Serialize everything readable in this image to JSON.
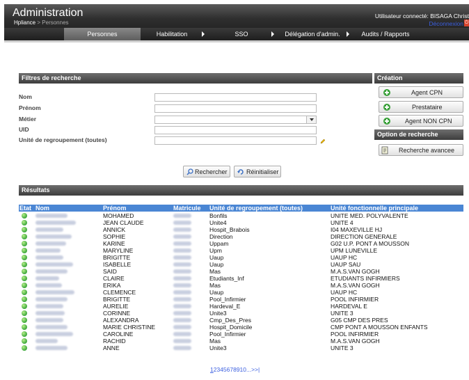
{
  "header": {
    "title": "Administration",
    "breadcrumb_root": "Hpliance",
    "breadcrumb_sep": ">",
    "breadcrumb_current": "Personnes",
    "user_info": "Utilisateur connecté: BISAGA Christ",
    "logout": "Déconnexion"
  },
  "nav": {
    "items": [
      {
        "label": "Personnes"
      },
      {
        "label": "Habilitation"
      },
      {
        "label": "SSO"
      },
      {
        "label": "Délégation d'admin."
      },
      {
        "label": "Audits / Rapports"
      }
    ]
  },
  "filters": {
    "title": "Filtres de recherche",
    "nom_label": "Nom",
    "nom_value": "",
    "prenom_label": "Prénom",
    "prenom_value": "",
    "metier_label": "Métier",
    "metier_value": "",
    "uid_label": "UID",
    "uid_value": "",
    "unite_label": "Unité de regroupement (toutes)",
    "unite_value": "",
    "search_button": "Rechercher",
    "reset_button": "Réinitialiser"
  },
  "creation": {
    "title": "Création",
    "buttons": [
      "Agent CPN",
      "Prestataire",
      "Agent NON CPN"
    ]
  },
  "search_options": {
    "title": "Option de recherche",
    "advanced_button": "Recherche avancee"
  },
  "results": {
    "title": "Résultats",
    "columns": [
      "Etat",
      "Nom",
      "Prénom",
      "Matricule",
      "Unité de regroupement (toutes)",
      "Unité fonctionnelle principale"
    ],
    "rows": [
      {
        "prenom": "MOHAMED",
        "unite": "Bonfils",
        "ufp": "UNITE MED. POLYVALENTE"
      },
      {
        "prenom": "JEAN CLAUDE",
        "unite": "Unite4",
        "ufp": "UNITE 4"
      },
      {
        "prenom": "ANNICK",
        "unite": "Hospit_Brabois",
        "ufp": "I04 MAXEVILLE HJ"
      },
      {
        "prenom": "SOPHIE",
        "unite": "Direction",
        "ufp": "DIRECTION GENERALE"
      },
      {
        "prenom": "KARINE",
        "unite": "Uppam",
        "ufp": "G02 U.P. PONT A MOUSSON"
      },
      {
        "prenom": "MARYLINE",
        "unite": "Upm",
        "ufp": "UPM LUNEVILLE"
      },
      {
        "prenom": "BRIGITTE",
        "unite": "Uaup",
        "ufp": "UAUP HC"
      },
      {
        "prenom": "ISABELLE",
        "unite": "Uaup",
        "ufp": "UAUP SAU"
      },
      {
        "prenom": "SAID",
        "unite": "Mas",
        "ufp": "M.A.S.VAN GOGH"
      },
      {
        "prenom": "CLAIRE",
        "unite": "Etudiants_Inf",
        "ufp": "ETUDIANTS INFIRMIERS"
      },
      {
        "prenom": "ERIKA",
        "unite": "Mas",
        "ufp": "M.A.S.VAN GOGH"
      },
      {
        "prenom": "CLEMENCE",
        "unite": "Uaup",
        "ufp": "UAUP HC"
      },
      {
        "prenom": "BRIGITTE",
        "unite": "Pool_Infirmier",
        "ufp": "POOL INFIRMIER"
      },
      {
        "prenom": "AURELIE",
        "unite": "Hardeval_E",
        "ufp": "HARDEVAL E"
      },
      {
        "prenom": "CORINNE",
        "unite": "Unite3",
        "ufp": "UNITE 3"
      },
      {
        "prenom": "ALEXANDRA",
        "unite": "Cmp_Des_Pres",
        "ufp": "G05 CMP DES PRES"
      },
      {
        "prenom": "MARIE CHRISTINE",
        "unite": "Hospit_Domicile",
        "ufp": "CMP PONT A MOUSSON ENFANTS"
      },
      {
        "prenom": "CAROLINE",
        "unite": "Pool_Infirmier",
        "ufp": "POOL INFIRMIER"
      },
      {
        "prenom": "RACHID",
        "unite": "Mas",
        "ufp": "M.A.S.VAN GOGH"
      },
      {
        "prenom": "ANNE",
        "unite": "Unite3",
        "ufp": "UNITE 3"
      }
    ],
    "pager_current": "1",
    "pager_rest": "2345678910...>>|"
  },
  "colors": {
    "header_bg": "#2f2f2f",
    "table_header_bg": "#4a86d4",
    "status_active": "#3aa63a",
    "link": "#3b5fe0"
  }
}
